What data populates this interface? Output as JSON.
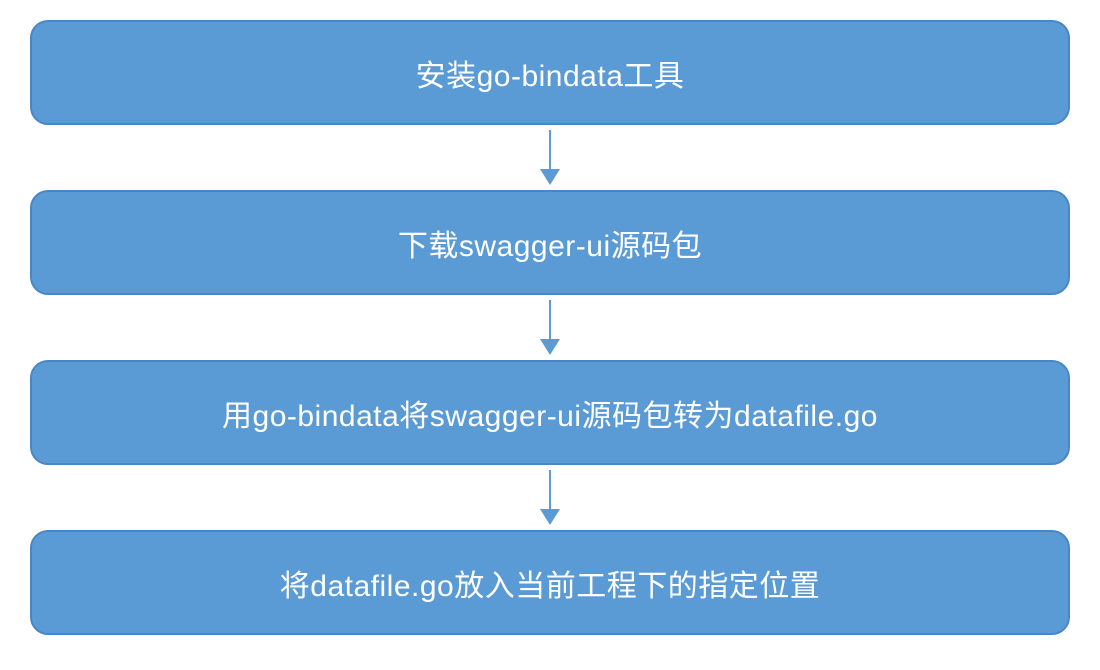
{
  "diagram": {
    "type": "flowchart-vertical",
    "box_color": "#5B9BD5",
    "border_color": "#4A86C5",
    "arrow_color": "#5B9BD5",
    "steps": [
      {
        "label": "安装go-bindata工具"
      },
      {
        "label": "下载swagger-ui源码包"
      },
      {
        "label": "用go-bindata将swagger-ui源码包转为datafile.go"
      },
      {
        "label": "将datafile.go放入当前工程下的指定位置"
      }
    ]
  }
}
